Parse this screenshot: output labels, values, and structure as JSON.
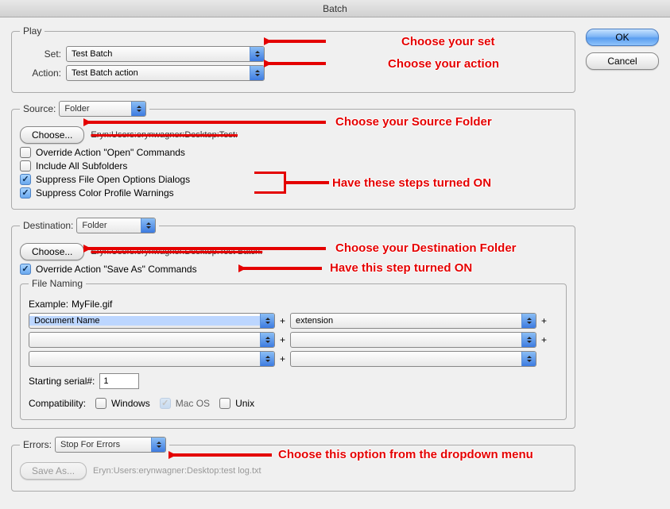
{
  "window": {
    "title": "Batch"
  },
  "buttons": {
    "ok": "OK",
    "cancel": "Cancel",
    "choose": "Choose...",
    "save_as": "Save As..."
  },
  "play": {
    "legend": "Play",
    "set_label": "Set:",
    "set_value": "Test  Batch",
    "action_label": "Action:",
    "action_value": "Test  Batch action"
  },
  "source": {
    "label": "Source:",
    "value": "Folder",
    "path": "Eryn:Users:erynwagner:Desktop:Test:",
    "cb_override": "Override Action \"Open\" Commands",
    "cb_subfolders": "Include All Subfolders",
    "cb_suppress_open": "Suppress File Open Options Dialogs",
    "cb_suppress_color": "Suppress Color Profile Warnings"
  },
  "dest": {
    "label": "Destination:",
    "value": "Folder",
    "path": "Eryn:Users:erynwagner:Desktop:Test Batch:",
    "cb_override_save": "Override Action \"Save As\" Commands"
  },
  "naming": {
    "legend": "File Naming",
    "example_label": "Example:",
    "example_value": "MyFile.gif",
    "slots": [
      "Document Name",
      "extension",
      "",
      "",
      "",
      ""
    ],
    "starting_label": "Starting serial#:",
    "starting_value": "1",
    "compat_label": "Compatibility:",
    "compat_windows": "Windows",
    "compat_mac": "Mac OS",
    "compat_unix": "Unix"
  },
  "errors": {
    "label": "Errors:",
    "value": "Stop For Errors",
    "log_path": "Eryn:Users:erynwagner:Desktop:test log.txt"
  },
  "annotations": {
    "choose_set": "Choose your set",
    "choose_action": "Choose your action",
    "choose_source": "Choose your Source Folder",
    "steps_on": "Have these steps turned ON",
    "choose_dest": "Choose your Destination Folder",
    "step_on": "Have this step turned ON",
    "choose_errors": "Choose this option from the dropdown menu"
  }
}
